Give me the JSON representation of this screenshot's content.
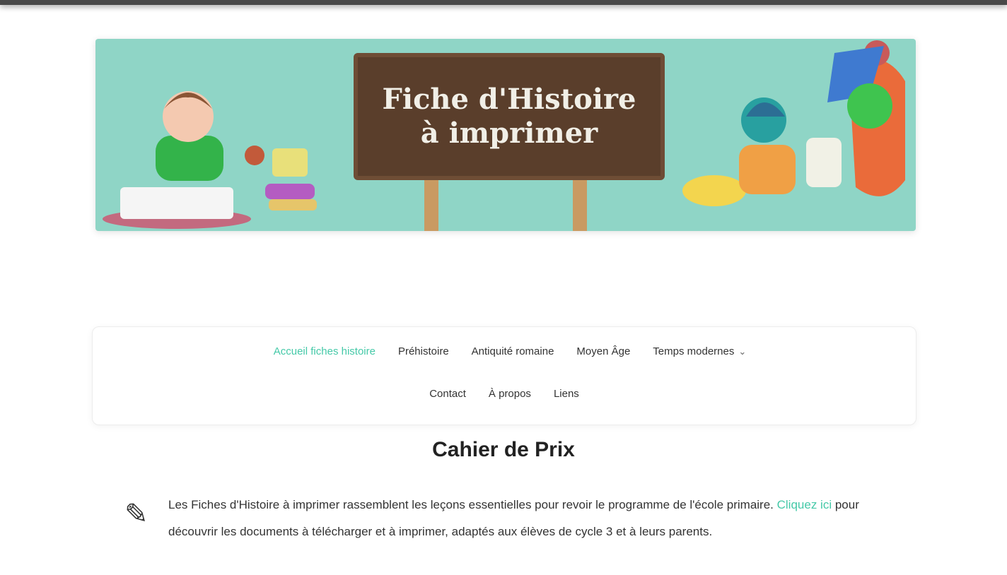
{
  "banner": {
    "board_line_1": "Fiche d'Histoire",
    "board_line_2": "à imprimer"
  },
  "nav": {
    "row1": [
      {
        "label": "Accueil fiches histoire",
        "active": true
      },
      {
        "label": "Préhistoire",
        "active": false
      },
      {
        "label": "Antiquité romaine",
        "active": false
      },
      {
        "label": "Moyen Âge",
        "active": false
      },
      {
        "label": "Temps modernes",
        "active": false,
        "has_dropdown": true
      }
    ],
    "row2": [
      {
        "label": "Contact"
      },
      {
        "label": "À propos"
      },
      {
        "label": "Liens"
      }
    ]
  },
  "content": {
    "title": "Cahier de Prix",
    "paragraph_prefix": "Les Fiches d'Histoire à imprimer rassemblent les leçons essentielles pour revoir le programme de l'école primaire.",
    "paragraph_link": "Cliquez ici",
    "paragraph_suffix": "pour découvrir les documents à télécharger et à imprimer, adaptés aux élèves de cycle 3 et à leurs parents."
  }
}
